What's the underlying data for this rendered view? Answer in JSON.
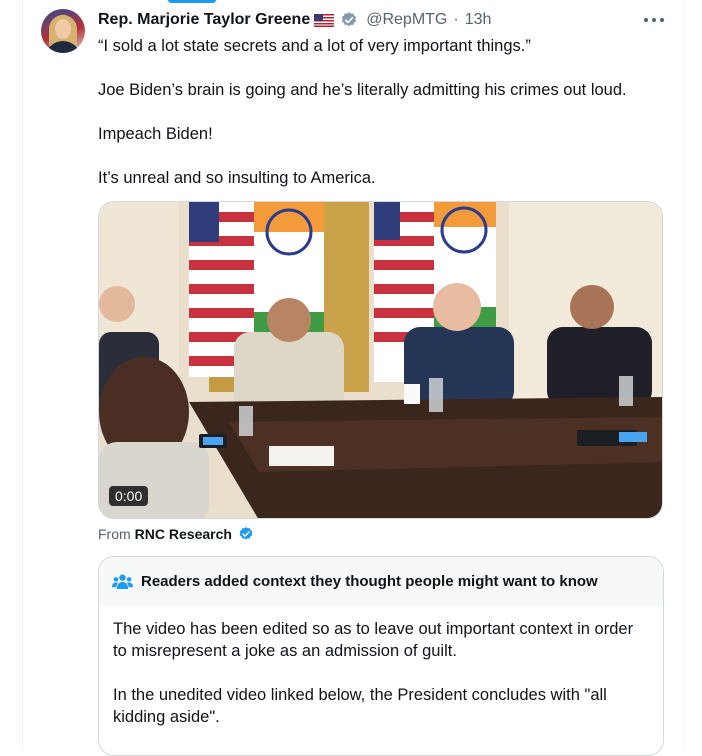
{
  "post": {
    "author": {
      "display_name": "Rep. Marjorie Taylor Greene",
      "handle": "@RepMTG",
      "flag_icon": "us-flag-icon",
      "verified_icon": "verified-badge-icon"
    },
    "separator": "·",
    "time_ago": "13h",
    "more_icon": "more-icon",
    "text_lines": [
      "“I sold a lot state secrets and a lot of very important things.”",
      "Joe Biden’s brain is going and he’s literally admitting his crimes out loud.",
      "Impeach Biden!",
      "It’s unreal and so insulting to America."
    ],
    "media": {
      "type": "video",
      "duration": "0:00"
    },
    "source": {
      "prefix": "From",
      "name": "RNC Research"
    }
  },
  "community_note": {
    "icon": "people-icon",
    "header": "Readers added context they thought people might want to know",
    "paragraphs": [
      "The video has been edited so as to leave out important context in order to misrepresent a joke as an admission of guilt.",
      "In the unedited video linked below, the President concludes with \"all kidding aside\"."
    ]
  },
  "colors": {
    "accent": "#1d9bf0",
    "text_primary": "#0f1419",
    "text_secondary": "#536471",
    "border": "#cfd9de",
    "note_header_bg": "#f7f9f9"
  }
}
